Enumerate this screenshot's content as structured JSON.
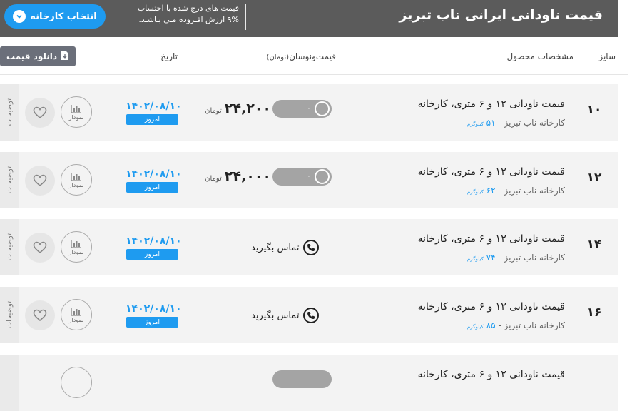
{
  "header": {
    "title": "قیمت ناودانی ایرانی ناب تبریز",
    "note_line1": "قیمت های درج شده با احتساب",
    "note_line2": "۹% ارزش افـزوده مـی بـاشـد.",
    "select_button": "انتخاب کارخانه"
  },
  "table": {
    "columns": {
      "size": "سایز",
      "specs": "مشخصات محصول",
      "price": "قیمت‌ونوسان",
      "price_unit": "(تومان)",
      "date": "تاریخ"
    },
    "download_button": "دانلود قیمت"
  },
  "rows": [
    {
      "size": "۱۰",
      "name": "قیمت ناودانی ۱۲ و ۶ متری، کارخانه",
      "factory": "کارخانه ناب تبریز - ",
      "weight": "۵۱",
      "weight_unit": "کیلوگرم",
      "price": "۲۴,۲۰۰",
      "currency": "تومان",
      "change": "۰",
      "date": "۱۴۰۲/۰۸/۱۰",
      "today": "امروز",
      "chart_label": "نمودار",
      "tab": "توضیحات"
    },
    {
      "size": "۱۲",
      "name": "قیمت ناودانی ۱۲ و ۶ متری، کارخانه",
      "factory": "کارخانه ناب تبریز - ",
      "weight": "۶۲",
      "weight_unit": "کیلوگرم",
      "price": "۲۴,۰۰۰",
      "currency": "تومان",
      "change": "۰",
      "date": "۱۴۰۲/۰۸/۱۰",
      "today": "امروز",
      "chart_label": "نمودار",
      "tab": "توضیحات"
    },
    {
      "size": "۱۴",
      "name": "قیمت ناودانی ۱۲ و ۶ متری، کارخانه",
      "factory": "کارخانه ناب تبریز - ",
      "weight": "۷۴",
      "weight_unit": "کیلوگرم",
      "call": "تماس بگیرید",
      "date": "۱۴۰۲/۰۸/۱۰",
      "today": "امروز",
      "chart_label": "نمودار",
      "tab": "توضیحات"
    },
    {
      "size": "۱۶",
      "name": "قیمت ناودانی ۱۲ و ۶ متری، کارخانه",
      "factory": "کارخانه ناب تبریز - ",
      "weight": "۸۵",
      "weight_unit": "کیلوگرم",
      "call": "تماس بگیرید",
      "date": "۱۴۰۲/۰۸/۱۰",
      "today": "امروز",
      "chart_label": "نمودار",
      "tab": "توضیحات"
    },
    {
      "name": "قیمت ناودانی ۱۲ و ۶ متری، کارخانه"
    }
  ],
  "colors": {
    "accent": "#1e9bf0",
    "header_bg": "#5b5b5b",
    "row_bg": "#f3f3f3"
  },
  "icons": [
    "chevron-down-icon",
    "download-icon",
    "heart-icon",
    "bar-chart-icon",
    "phone-icon"
  ]
}
